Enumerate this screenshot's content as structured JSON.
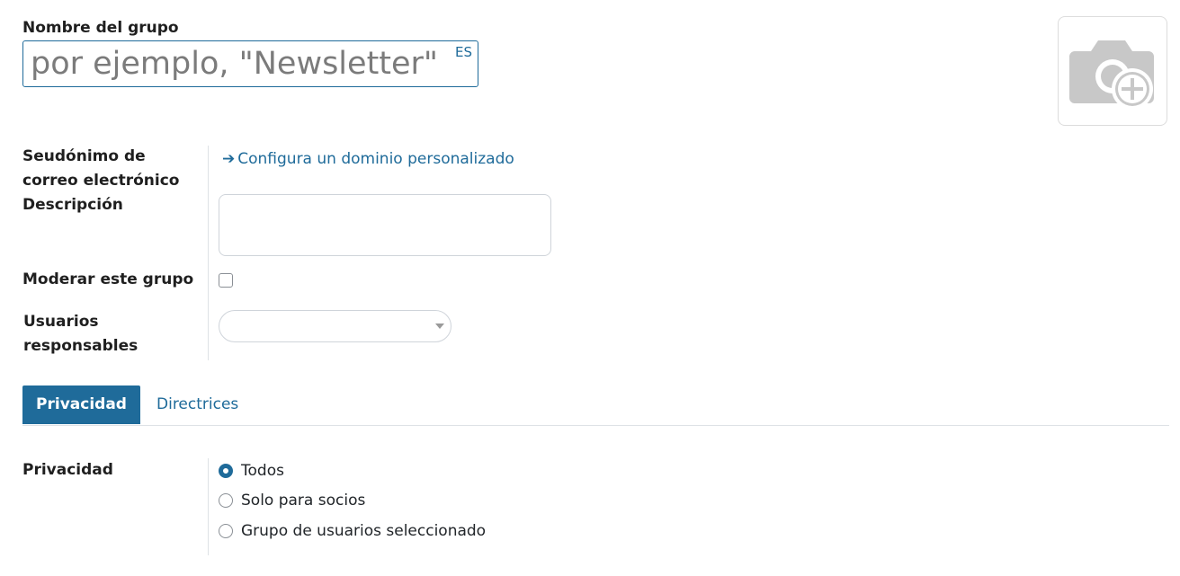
{
  "header": {
    "name_label": "Nombre del grupo",
    "name_value": "",
    "name_placeholder": "por ejemplo, \"Newsletter\"",
    "language_badge": "ES"
  },
  "avatar": {
    "icon": "camera-plus-icon"
  },
  "fields": {
    "alias_label": "Seudónimo de correo electrónico",
    "alias_link": "Configura un dominio personalizado",
    "alias_link_icon": "arrow-right-icon",
    "description_label": "Descripción",
    "description_value": "",
    "moderate_label": "Moderar este grupo",
    "moderate_checked": false,
    "responsible_label": "Usuarios responsables",
    "responsible_value": ""
  },
  "tabs": [
    {
      "label": "Privacidad",
      "active": true
    },
    {
      "label": "Directrices",
      "active": false
    }
  ],
  "privacy": {
    "label": "Privacidad",
    "options": [
      {
        "label": "Todos",
        "checked": true
      },
      {
        "label": "Solo para socios",
        "checked": false
      },
      {
        "label": "Grupo de usuarios seleccionado",
        "checked": false
      }
    ]
  },
  "colors": {
    "accent": "#1f6b9a",
    "border": "#cfd4da",
    "text": "#212529"
  }
}
